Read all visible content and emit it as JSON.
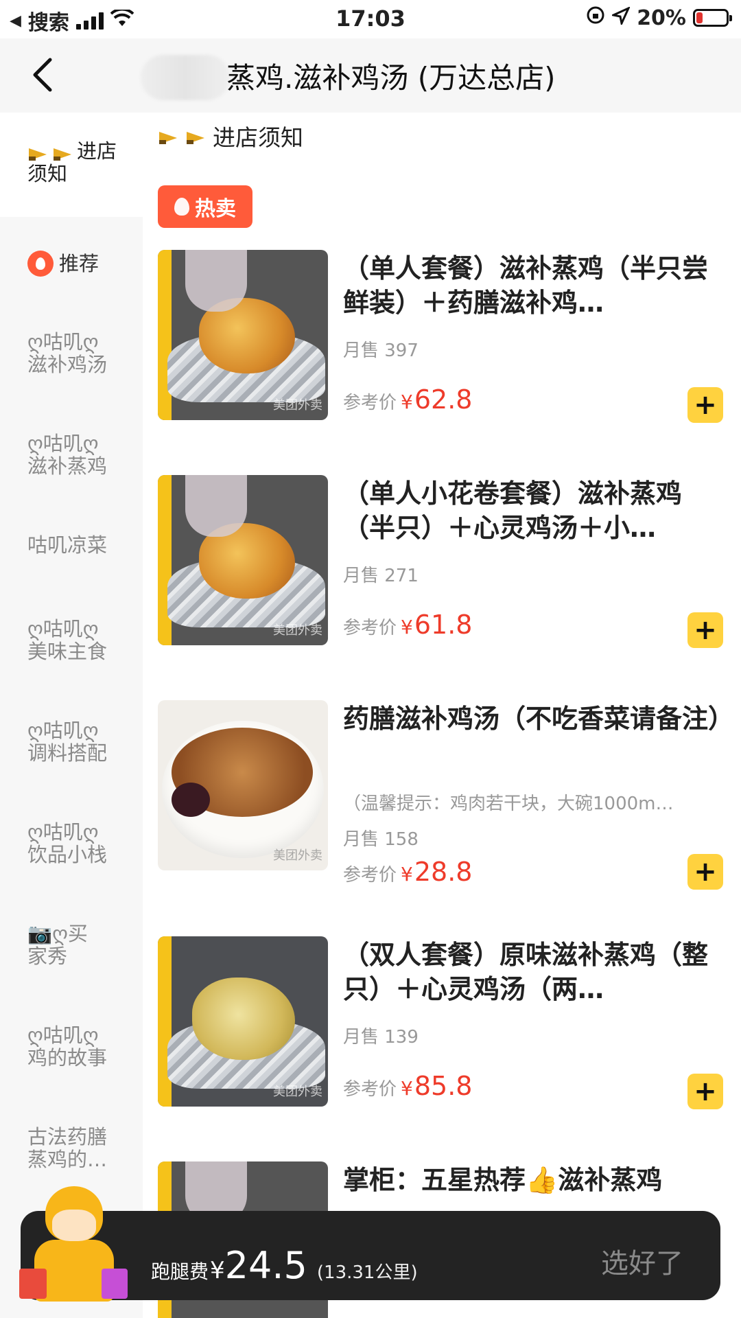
{
  "status": {
    "carrier": "搜索",
    "time": "17:03",
    "battery": "20%"
  },
  "nav": {
    "title": "蒸鸡.滋补鸡汤 (万达总店)"
  },
  "sidebar": {
    "items": [
      {
        "label": "进店须知"
      },
      {
        "label": "推荐"
      },
      {
        "label": "ღ咕叽ღ\n滋补鸡汤"
      },
      {
        "label": "ღ咕叽ღ\n滋补蒸鸡"
      },
      {
        "label": "咕叽凉菜"
      },
      {
        "label": "ღ咕叽ღ\n美味主食"
      },
      {
        "label": "ღ咕叽ღ\n调料搭配"
      },
      {
        "label": "ღ咕叽ღ\n饮品小栈"
      },
      {
        "label": "📷ღ买\n家秀"
      },
      {
        "label": "ღ咕叽ღ\n鸡的故事"
      },
      {
        "label": "古法药膳\n蒸鸡的…"
      }
    ]
  },
  "main": {
    "notice": "进店须知",
    "hot_tag": "热卖",
    "price_label": "参考价",
    "currency": "¥",
    "sold_prefix": "月售",
    "items": [
      {
        "name": "（单人套餐）滋补蒸鸡（半只尝鲜装）＋药膳滋补鸡…",
        "sold": "月售 397",
        "price": "62.8"
      },
      {
        "name": "（单人小花卷套餐）滋补蒸鸡（半只）＋心灵鸡汤＋小…",
        "sold": "月售 271",
        "price": "61.8"
      },
      {
        "name": "药膳滋补鸡汤（不吃香菜请备注）",
        "desc": "（温馨提示：鸡肉若干块，大碗1000m…",
        "sold": "月售 158",
        "price": "28.8"
      },
      {
        "name": "（双人套餐）原味滋补蒸鸡（整只）＋心灵鸡汤（两…",
        "sold": "月售 139",
        "price": "85.8"
      },
      {
        "name": "掌柜：五星热荐👍滋补蒸鸡"
      }
    ]
  },
  "cart": {
    "fee_label": "跑腿费",
    "currency": "¥",
    "fee": "24.5",
    "distance": "(13.31公里)",
    "done": "选好了"
  },
  "colors": {
    "accent_price": "#ee3b2a",
    "add_button": "#ffd23f",
    "hot_tag": "#ff5b3a",
    "cart_bar": "#232323"
  }
}
